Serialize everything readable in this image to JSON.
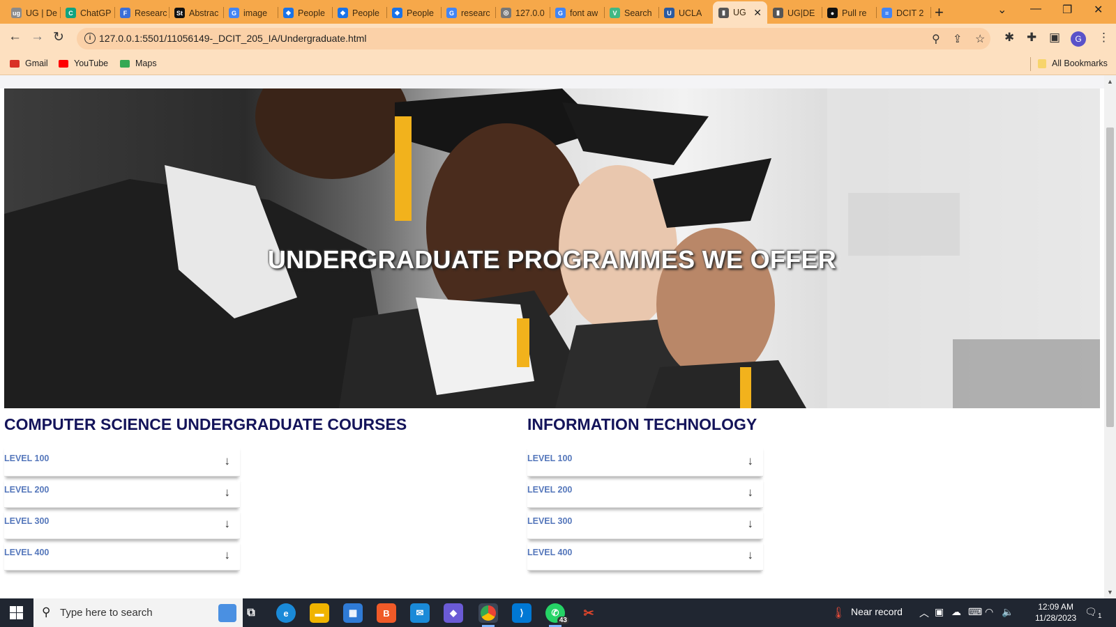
{
  "browser": {
    "tabs": [
      {
        "label": "UG | De",
        "color": "#8a8a8a",
        "glyph": "ug"
      },
      {
        "label": "ChatGP",
        "color": "#10a37f",
        "glyph": "C"
      },
      {
        "label": "Researc",
        "color": "#3b6fd8",
        "glyph": "F"
      },
      {
        "label": "Abstrac",
        "color": "#111111",
        "glyph": "St"
      },
      {
        "label": "image",
        "color": "#4285f4",
        "glyph": "G"
      },
      {
        "label": "People",
        "color": "#1a73e8",
        "glyph": "◆"
      },
      {
        "label": "People",
        "color": "#1a73e8",
        "glyph": "◆"
      },
      {
        "label": "People",
        "color": "#1a73e8",
        "glyph": "◆"
      },
      {
        "label": "researc",
        "color": "#4285f4",
        "glyph": "G"
      },
      {
        "label": "127.0.0",
        "color": "#777777",
        "glyph": "◎"
      },
      {
        "label": "font aw",
        "color": "#4285f4",
        "glyph": "G"
      },
      {
        "label": "Search",
        "color": "#41b883",
        "glyph": "V"
      },
      {
        "label": "UCLA",
        "color": "#2a5aa0",
        "glyph": "U"
      },
      {
        "label": "UG",
        "color": "#555555",
        "glyph": "▮",
        "active": true
      },
      {
        "label": "UG|DE",
        "color": "#555555",
        "glyph": "▮"
      },
      {
        "label": "Pull re",
        "color": "#111111",
        "glyph": "●"
      },
      {
        "label": "DCIT 2",
        "color": "#4285f4",
        "glyph": "≡"
      }
    ],
    "url": "127.0.0.1:5501/11056149-_DCIT_205_IA/Undergraduate.html",
    "profile_initial": "G",
    "bookmarks": [
      {
        "label": "Gmail",
        "color": "#d93025"
      },
      {
        "label": "YouTube",
        "color": "#ff0000"
      },
      {
        "label": "Maps",
        "color": "#34a853"
      }
    ],
    "all_bookmarks": "All Bookmarks"
  },
  "page": {
    "hero_title": "UNDERGRADUATE PROGRAMMES WE OFFER",
    "sections": [
      {
        "title": "COMPUTER SCIENCE UNDERGRADUATE COURSES",
        "levels": [
          "LEVEL 100",
          "LEVEL 200",
          "LEVEL 300",
          "LEVEL 400"
        ]
      },
      {
        "title": "INFORMATION TECHNOLOGY",
        "levels": [
          "LEVEL 100",
          "LEVEL 200",
          "LEVEL 300",
          "LEVEL 400"
        ]
      }
    ],
    "expand_arrow": "↓"
  },
  "taskbar": {
    "search_placeholder": "Type here to search",
    "weather": "Near record",
    "time": "12:09 AM",
    "date": "11/28/2023",
    "whatsapp_badge": "43",
    "notification_count": "1"
  }
}
